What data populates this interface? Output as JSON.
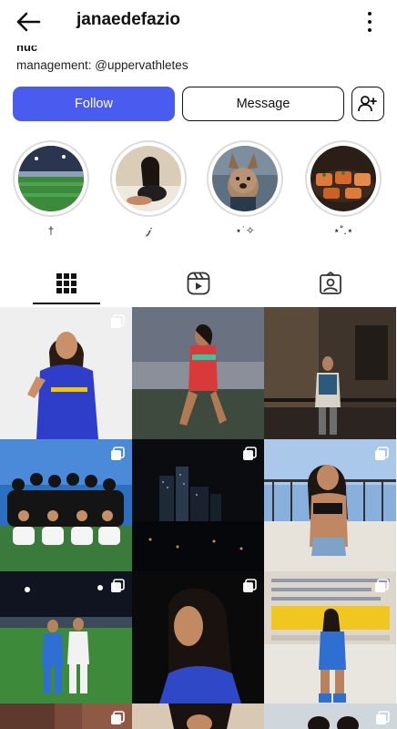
{
  "header": {
    "username": "janaedefazio",
    "back_icon": "arrow-left-icon",
    "more_icon": "vertical-dots-icon"
  },
  "bio": {
    "cut_line": "nuc",
    "management": "management: @uppervathletes"
  },
  "actions": {
    "follow_label": "Follow",
    "message_label": "Message",
    "suggest_icon": "person-add-icon"
  },
  "highlights": [
    {
      "label": "†",
      "theme": "stadium-night"
    },
    {
      "label": "𝒿",
      "theme": "woman-portrait"
    },
    {
      "label": "⋆˙✧",
      "theme": "dog"
    },
    {
      "label": "⋆˚.⋆",
      "theme": "sushi"
    }
  ],
  "tabs": [
    {
      "icon": "grid-icon",
      "active": true
    },
    {
      "icon": "reels-icon",
      "active": false
    },
    {
      "icon": "tagged-icon",
      "active": false
    }
  ],
  "posts": [
    {
      "desc": "ucla-jersey-portrait",
      "multi": true
    },
    {
      "desc": "soccer-match-action",
      "multi": false
    },
    {
      "desc": "night-city-balcony",
      "multi": false
    },
    {
      "desc": "team-photo-field",
      "multi": true
    },
    {
      "desc": "night-skyline",
      "multi": true
    },
    {
      "desc": "bikini-balcony",
      "multi": true
    },
    {
      "desc": "stadium-teammates",
      "multi": true
    },
    {
      "desc": "profile-portrait",
      "multi": true
    },
    {
      "desc": "ucla-wall",
      "multi": true
    },
    {
      "desc": "partial-row-1",
      "multi": true
    },
    {
      "desc": "partial-row-2",
      "multi": false
    },
    {
      "desc": "partial-row-3",
      "multi": true
    }
  ],
  "colors": {
    "accent": "#4a5cf0",
    "ucla_blue": "#2f6fd1",
    "ucla_gold": "#f5c400"
  }
}
